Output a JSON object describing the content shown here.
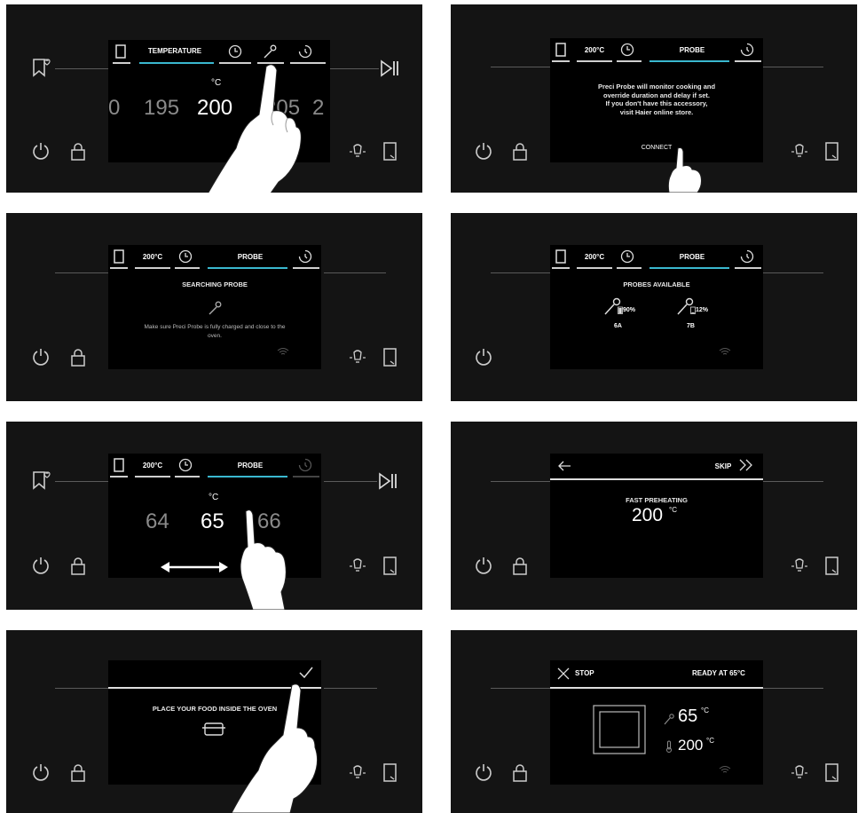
{
  "colors": {
    "accent": "#3ab8cf",
    "panel": "#141414",
    "screen": "#000000"
  },
  "icons": [
    "bookmark-heart-icon",
    "play-pause-icon",
    "power-icon",
    "lock-icon",
    "lamp-icon",
    "door-icon",
    "clock-icon",
    "probe-icon",
    "timer-icon",
    "oven-icon",
    "wifi-icon",
    "arrow-left-icon",
    "skip-icon",
    "check-icon",
    "close-icon",
    "dish-icon",
    "thermometer-icon"
  ],
  "p1": {
    "tab_temperature": "TEMPERATURE",
    "unit": "°C",
    "values": [
      "0",
      "195",
      "200",
      "205",
      "2"
    ]
  },
  "p2": {
    "tab_temp": "200°C",
    "tab_probe": "PROBE",
    "message": [
      "Preci Probe will monitor cooking and",
      "override duration and delay if set.",
      "If you don't have this accessory,",
      "visit Haier online store."
    ],
    "connect": "CONNECT"
  },
  "p3": {
    "tab_temp": "200°C",
    "tab_probe": "PROBE",
    "title": "SEARCHING PROBE",
    "message": [
      "Make sure Preci Probe is fully charged and close to the",
      "oven."
    ]
  },
  "p4": {
    "tab_temp": "200°C",
    "tab_probe": "PROBE",
    "title": "PROBES AVAILABLE",
    "probes": [
      {
        "battery": "90%",
        "id": "6A"
      },
      {
        "battery": "12%",
        "id": "7B"
      }
    ]
  },
  "p5": {
    "tab_temp": "200°C",
    "tab_probe": "PROBE",
    "unit": "°C",
    "values": [
      "64",
      "65",
      "66"
    ]
  },
  "p6": {
    "skip": "SKIP",
    "title": "FAST PREHEATING",
    "temp": "200",
    "unit": "°C"
  },
  "p7": {
    "message": "PLACE YOUR FOOD INSIDE THE OVEN"
  },
  "p8": {
    "stop": "STOP",
    "status": "READY AT 65°C",
    "probe_temp": "65",
    "oven_temp": "200",
    "unit": "°C"
  }
}
